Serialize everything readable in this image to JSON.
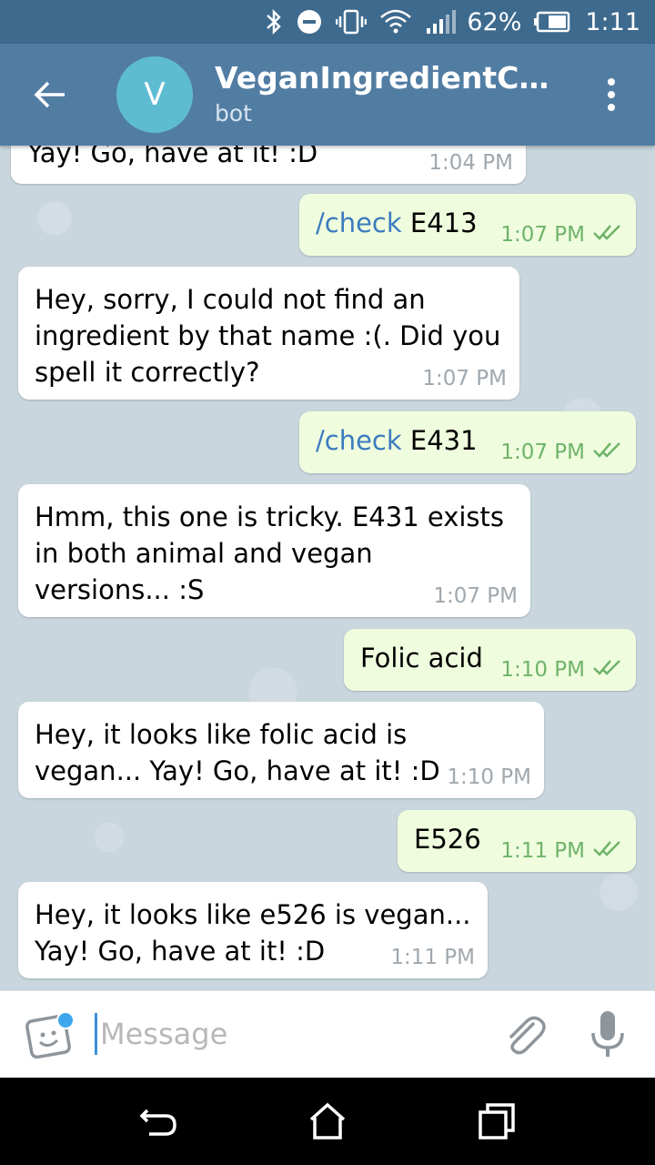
{
  "status_bar": {
    "battery_percent": "62%",
    "time": "1:11",
    "icons": [
      "bluetooth-icon",
      "do-not-disturb-icon",
      "vibrate-icon",
      "wifi-icon",
      "signal-icon",
      "battery-icon"
    ]
  },
  "header": {
    "avatar_letter": "V",
    "title": "VeganIngredientChec...",
    "subtitle": "bot",
    "avatar_color": "#5ebcd2",
    "bar_color": "#527da3"
  },
  "messages": [
    {
      "dir": "in",
      "text": "Yay! Go, have at it! :D",
      "time": "1:04 PM"
    },
    {
      "dir": "out",
      "command": "/check",
      "text": " E413",
      "time": "1:07 PM"
    },
    {
      "dir": "in",
      "text": "Hey, sorry, I could not find an\ningredient by that name :(. Did you\nspell it correctly?",
      "time": "1:07 PM"
    },
    {
      "dir": "out",
      "command": "/check",
      "text": " E431",
      "time": "1:07 PM"
    },
    {
      "dir": "in",
      "text": "Hmm, this one is tricky. E431 exists\nin both animal and vegan\nversions... :S",
      "time": "1:07 PM"
    },
    {
      "dir": "out",
      "text": "Folic acid",
      "time": "1:10 PM"
    },
    {
      "dir": "in",
      "text": "Hey, it looks like folic acid is\nvegan... Yay! Go, have at it! :D",
      "time": "1:10 PM"
    },
    {
      "dir": "out",
      "text": "E526",
      "time": "1:11 PM"
    },
    {
      "dir": "in",
      "text": "Hey, it looks like e526 is vegan...\nYay! Go, have at it! :D",
      "time": "1:11 PM"
    }
  ],
  "composer": {
    "placeholder": "Message"
  },
  "colors": {
    "incoming_bubble": "#ffffff",
    "outgoing_bubble": "#effdde",
    "command_link": "#3b7bbf",
    "read_ticks": "#6fb36a"
  }
}
